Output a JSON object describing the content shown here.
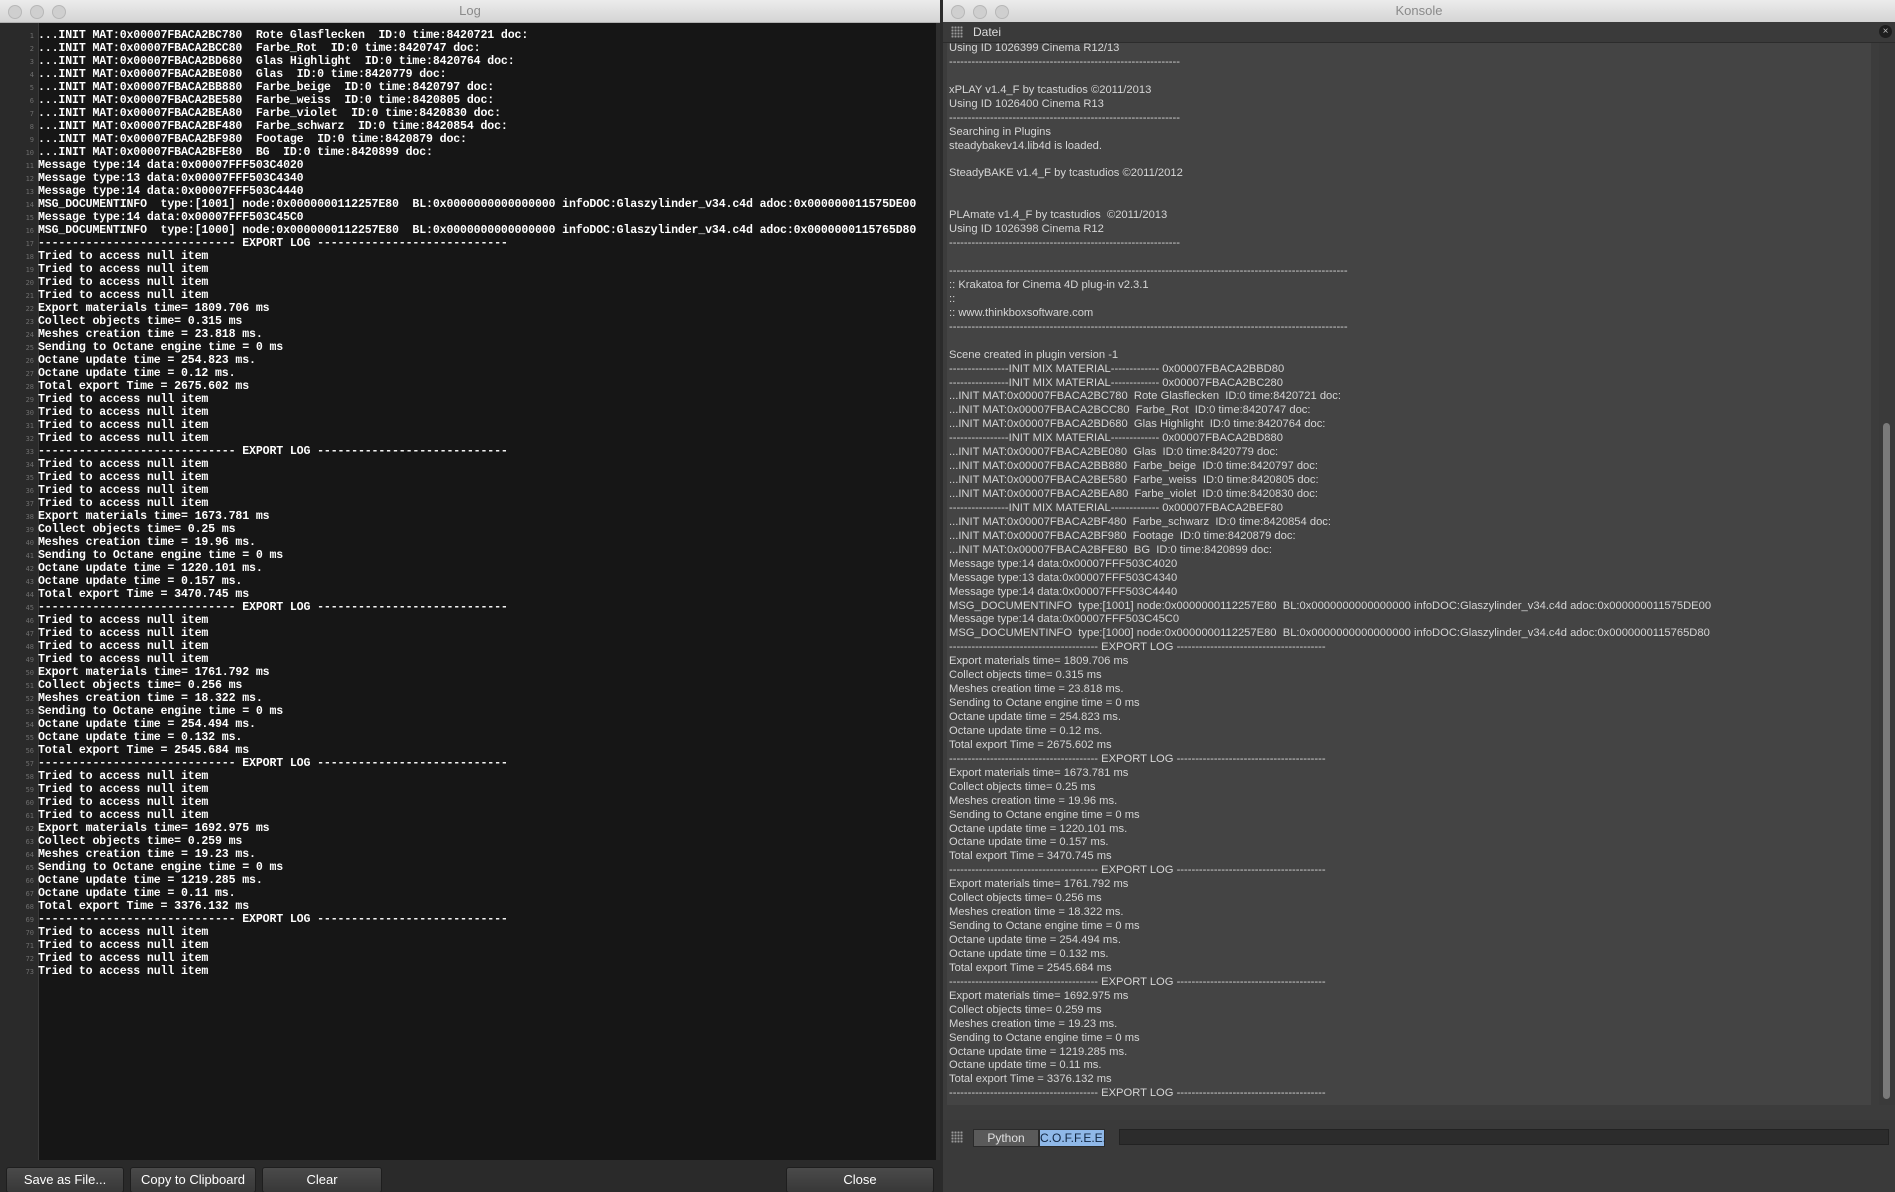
{
  "log_window": {
    "title": "Log",
    "lines": [
      "...INIT MAT:0x00007FBACA2BC780  Rote Glasflecken  ID:0 time:8420721 doc:",
      "...INIT MAT:0x00007FBACA2BCC80  Farbe_Rot  ID:0 time:8420747 doc:",
      "...INIT MAT:0x00007FBACA2BD680  Glas Highlight  ID:0 time:8420764 doc:",
      "...INIT MAT:0x00007FBACA2BE080  Glas  ID:0 time:8420779 doc:",
      "...INIT MAT:0x00007FBACA2BB880  Farbe_beige  ID:0 time:8420797 doc:",
      "...INIT MAT:0x00007FBACA2BE580  Farbe_weiss  ID:0 time:8420805 doc:",
      "...INIT MAT:0x00007FBACA2BEA80  Farbe_violet  ID:0 time:8420830 doc:",
      "...INIT MAT:0x00007FBACA2BF480  Farbe_schwarz  ID:0 time:8420854 doc:",
      "...INIT MAT:0x00007FBACA2BF980  Footage  ID:0 time:8420879 doc:",
      "...INIT MAT:0x00007FBACA2BFE80  BG  ID:0 time:8420899 doc:",
      "Message type:14 data:0x00007FFF503C4020",
      "Message type:13 data:0x00007FFF503C4340",
      "Message type:14 data:0x00007FFF503C4440",
      "MSG_DOCUMENTINFO  type:[1001] node:0x0000000112257E80  BL:0x0000000000000000 infoDOC:Glaszylinder_v34.c4d adoc:0x000000011575DE00",
      "Message type:14 data:0x00007FFF503C45C0",
      "MSG_DOCUMENTINFO  type:[1000] node:0x0000000112257E80  BL:0x0000000000000000 infoDOC:Glaszylinder_v34.c4d adoc:0x0000000115765D80",
      "----------------------------- EXPORT LOG ----------------------------",
      "Tried to access null item",
      "Tried to access null item",
      "Tried to access null item",
      "Tried to access null item",
      "Export materials time= 1809.706 ms",
      "Collect objects time= 0.315 ms",
      "Meshes creation time = 23.818 ms.",
      "Sending to Octane engine time = 0 ms",
      "Octane update time = 254.823 ms.",
      "Octane update time = 0.12 ms.",
      "Total export Time = 2675.602 ms",
      "Tried to access null item",
      "Tried to access null item",
      "Tried to access null item",
      "Tried to access null item",
      "----------------------------- EXPORT LOG ----------------------------",
      "Tried to access null item",
      "Tried to access null item",
      "Tried to access null item",
      "Tried to access null item",
      "Export materials time= 1673.781 ms",
      "Collect objects time= 0.25 ms",
      "Meshes creation time = 19.96 ms.",
      "Sending to Octane engine time = 0 ms",
      "Octane update time = 1220.101 ms.",
      "Octane update time = 0.157 ms.",
      "Total export Time = 3470.745 ms",
      "----------------------------- EXPORT LOG ----------------------------",
      "Tried to access null item",
      "Tried to access null item",
      "Tried to access null item",
      "Tried to access null item",
      "Export materials time= 1761.792 ms",
      "Collect objects time= 0.256 ms",
      "Meshes creation time = 18.322 ms.",
      "Sending to Octane engine time = 0 ms",
      "Octane update time = 254.494 ms.",
      "Octane update time = 0.132 ms.",
      "Total export Time = 2545.684 ms",
      "----------------------------- EXPORT LOG ----------------------------",
      "Tried to access null item",
      "Tried to access null item",
      "Tried to access null item",
      "Tried to access null item",
      "Export materials time= 1692.975 ms",
      "Collect objects time= 0.259 ms",
      "Meshes creation time = 19.23 ms.",
      "Sending to Octane engine time = 0 ms",
      "Octane update time = 1219.285 ms.",
      "Octane update time = 0.11 ms.",
      "Total export Time = 3376.132 ms",
      "----------------------------- EXPORT LOG ----------------------------",
      "Tried to access null item",
      "Tried to access null item",
      "Tried to access null item",
      "Tried to access null item"
    ],
    "buttons": {
      "save": "Save as File...",
      "copy": "Copy to Clipboard",
      "clear": "Clear",
      "close": "Close"
    }
  },
  "konsole_window": {
    "title": "Konsole",
    "menu": {
      "datei": "Datei"
    },
    "close_glyph": "×",
    "lines": [
      "Using ID 1026399 Cinema R12/13",
      "--------------------------------------------------------------",
      "",
      "xPLAY v1.4_F by tcastudios ©2011/2013",
      "Using ID 1026400 Cinema R13",
      "--------------------------------------------------------------",
      "Searching in Plugins",
      "steadybakev14.lib4d is loaded.",
      "",
      "SteadyBAKE v1.4_F by tcastudios ©2011/2012",
      "",
      "",
      "PLAmate v1.4_F by tcastudios  ©2011/2013",
      "Using ID 1026398 Cinema R12",
      "--------------------------------------------------------------",
      "",
      "-----------------------------------------------------------------------------------------------------------",
      ":: Krakatoa for Cinema 4D plug-in v2.3.1",
      "::",
      ":: www.thinkboxsoftware.com",
      "-----------------------------------------------------------------------------------------------------------",
      "",
      "Scene created in plugin version -1",
      "----------------INIT MIX MATERIAL------------- 0x00007FBACA2BBD80",
      "----------------INIT MIX MATERIAL------------- 0x00007FBACA2BC280",
      "...INIT MAT:0x00007FBACA2BC780  Rote Glasflecken  ID:0 time:8420721 doc:",
      "...INIT MAT:0x00007FBACA2BCC80  Farbe_Rot  ID:0 time:8420747 doc:",
      "...INIT MAT:0x00007FBACA2BD680  Glas Highlight  ID:0 time:8420764 doc:",
      "----------------INIT MIX MATERIAL------------- 0x00007FBACA2BD880",
      "...INIT MAT:0x00007FBACA2BE080  Glas  ID:0 time:8420779 doc:",
      "...INIT MAT:0x00007FBACA2BB880  Farbe_beige  ID:0 time:8420797 doc:",
      "...INIT MAT:0x00007FBACA2BE580  Farbe_weiss  ID:0 time:8420805 doc:",
      "...INIT MAT:0x00007FBACA2BEA80  Farbe_violet  ID:0 time:8420830 doc:",
      "----------------INIT MIX MATERIAL------------- 0x00007FBACA2BEF80",
      "...INIT MAT:0x00007FBACA2BF480  Farbe_schwarz  ID:0 time:8420854 doc:",
      "...INIT MAT:0x00007FBACA2BF980  Footage  ID:0 time:8420879 doc:",
      "...INIT MAT:0x00007FBACA2BFE80  BG  ID:0 time:8420899 doc:",
      "Message type:14 data:0x00007FFF503C4020",
      "Message type:13 data:0x00007FFF503C4340",
      "Message type:14 data:0x00007FFF503C4440",
      "MSG_DOCUMENTINFO  type:[1001] node:0x0000000112257E80  BL:0x0000000000000000 infoDOC:Glaszylinder_v34.c4d adoc:0x000000011575DE00",
      "Message type:14 data:0x00007FFF503C45C0",
      "MSG_DOCUMENTINFO  type:[1000] node:0x0000000112257E80  BL:0x0000000000000000 infoDOC:Glaszylinder_v34.c4d adoc:0x0000000115765D80",
      "---------------------------------------- EXPORT LOG ----------------------------------------",
      "Export materials time= 1809.706 ms",
      "Collect objects time= 0.315 ms",
      "Meshes creation time = 23.818 ms.",
      "Sending to Octane engine time = 0 ms",
      "Octane update time = 254.823 ms.",
      "Octane update time = 0.12 ms.",
      "Total export Time = 2675.602 ms",
      "---------------------------------------- EXPORT LOG ----------------------------------------",
      "Export materials time= 1673.781 ms",
      "Collect objects time= 0.25 ms",
      "Meshes creation time = 19.96 ms.",
      "Sending to Octane engine time = 0 ms",
      "Octane update time = 1220.101 ms.",
      "Octane update time = 0.157 ms.",
      "Total export Time = 3470.745 ms",
      "---------------------------------------- EXPORT LOG ----------------------------------------",
      "Export materials time= 1761.792 ms",
      "Collect objects time= 0.256 ms",
      "Meshes creation time = 18.322 ms.",
      "Sending to Octane engine time = 0 ms",
      "Octane update time = 254.494 ms.",
      "Octane update time = 0.132 ms.",
      "Total export Time = 2545.684 ms",
      "---------------------------------------- EXPORT LOG ----------------------------------------",
      "Export materials time= 1692.975 ms",
      "Collect objects time= 0.259 ms",
      "Meshes creation time = 19.23 ms.",
      "Sending to Octane engine time = 0 ms",
      "Octane update time = 1219.285 ms.",
      "Octane update time = 0.11 ms.",
      "Total export Time = 3376.132 ms",
      "---------------------------------------- EXPORT LOG ----------------------------------------"
    ],
    "tabs": {
      "python": "Python",
      "coffee": "C.O.F.F.E.E."
    },
    "command_value": ""
  }
}
